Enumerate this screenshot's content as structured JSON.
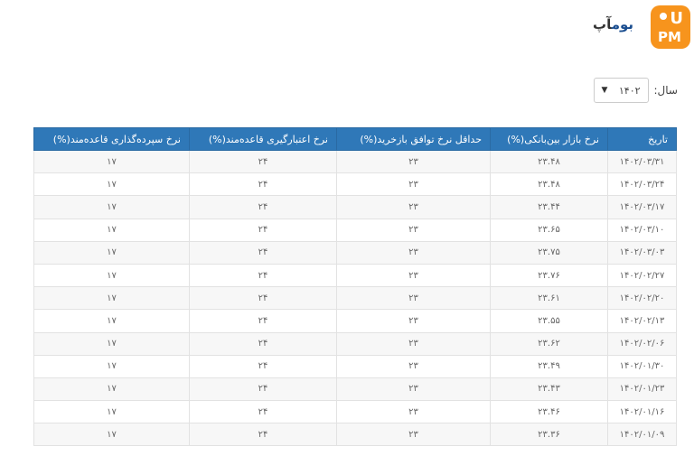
{
  "logo": {
    "text_main": "بوم",
    "text_brand": "آپ",
    "badge_top": "U",
    "badge_bottom": "PM"
  },
  "filter": {
    "label": "سال:",
    "selected": "۱۴۰۲",
    "chevron_icon": "chevron-down-icon"
  },
  "table": {
    "headers": {
      "date": "تاریخ",
      "interbank": "نرخ بازار بین‌بانکی(%)",
      "repo": "حداقل نرخ توافق بازخرید(%)",
      "credit": "نرخ اعتبارگیری قاعده‌مند(%)",
      "deposit": "نرخ سپرده‌گذاری قاعده‌مند(%)"
    },
    "rows": [
      {
        "date": "۱۴۰۲/۰۳/۳۱",
        "interbank": "۲۳.۴۸",
        "repo": "۲۳",
        "credit": "۲۴",
        "deposit": "۱۷"
      },
      {
        "date": "۱۴۰۲/۰۳/۲۴",
        "interbank": "۲۳.۴۸",
        "repo": "۲۳",
        "credit": "۲۴",
        "deposit": "۱۷"
      },
      {
        "date": "۱۴۰۲/۰۳/۱۷",
        "interbank": "۲۳.۴۴",
        "repo": "۲۳",
        "credit": "۲۴",
        "deposit": "۱۷"
      },
      {
        "date": "۱۴۰۲/۰۳/۱۰",
        "interbank": "۲۳.۶۵",
        "repo": "۲۳",
        "credit": "۲۴",
        "deposit": "۱۷"
      },
      {
        "date": "۱۴۰۲/۰۳/۰۳",
        "interbank": "۲۳.۷۵",
        "repo": "۲۳",
        "credit": "۲۴",
        "deposit": "۱۷"
      },
      {
        "date": "۱۴۰۲/۰۲/۲۷",
        "interbank": "۲۳.۷۶",
        "repo": "۲۳",
        "credit": "۲۴",
        "deposit": "۱۷"
      },
      {
        "date": "۱۴۰۲/۰۲/۲۰",
        "interbank": "۲۳.۶۱",
        "repo": "۲۳",
        "credit": "۲۴",
        "deposit": "۱۷"
      },
      {
        "date": "۱۴۰۲/۰۲/۱۳",
        "interbank": "۲۳.۵۵",
        "repo": "۲۳",
        "credit": "۲۴",
        "deposit": "۱۷"
      },
      {
        "date": "۱۴۰۲/۰۲/۰۶",
        "interbank": "۲۳.۶۲",
        "repo": "۲۳",
        "credit": "۲۴",
        "deposit": "۱۷"
      },
      {
        "date": "۱۴۰۲/۰۱/۳۰",
        "interbank": "۲۳.۴۹",
        "repo": "۲۳",
        "credit": "۲۴",
        "deposit": "۱۷"
      },
      {
        "date": "۱۴۰۲/۰۱/۲۳",
        "interbank": "۲۳.۴۳",
        "repo": "۲۳",
        "credit": "۲۴",
        "deposit": "۱۷"
      },
      {
        "date": "۱۴۰۲/۰۱/۱۶",
        "interbank": "۲۳.۴۶",
        "repo": "۲۳",
        "credit": "۲۴",
        "deposit": "۱۷"
      },
      {
        "date": "۱۴۰۲/۰۱/۰۹",
        "interbank": "۲۳.۳۶",
        "repo": "۲۳",
        "credit": "۲۴",
        "deposit": "۱۷"
      }
    ]
  },
  "colors": {
    "header_bg": "#2f78b8",
    "logo_orange": "#f7941d",
    "stripe": "#f7f7f7"
  }
}
